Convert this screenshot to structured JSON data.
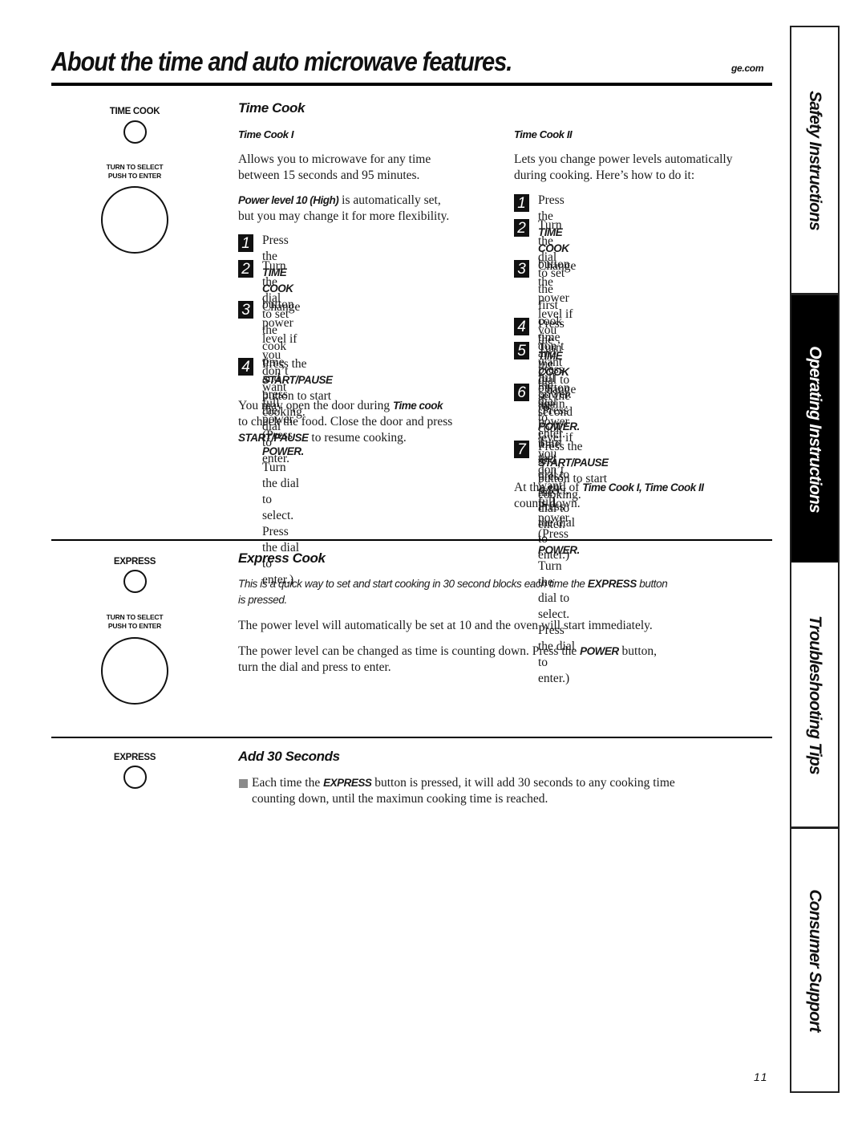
{
  "header": {
    "title": "About the time and auto microwave features.",
    "site": "ge.com"
  },
  "side_tabs": [
    {
      "label": "Safety Instructions",
      "active": false
    },
    {
      "label": "Operating Instructions",
      "active": true
    },
    {
      "label": "Troubleshooting Tips",
      "active": false
    },
    {
      "label": "Consumer Support",
      "active": false
    }
  ],
  "panels": {
    "time_cook": {
      "button_label": "TIME COOK",
      "dial_label_line1": "TURN TO SELECT",
      "dial_label_line2": "PUSH TO ENTER"
    },
    "express_cook": {
      "button_label": "EXPRESS",
      "dial_label_line1": "TURN TO SELECT",
      "dial_label_line2": "PUSH TO ENTER"
    },
    "add_30": {
      "button_label": "EXPRESS"
    }
  },
  "time_cook": {
    "heading": "Time Cook",
    "col1": {
      "subheading": "Time Cook I",
      "intro_line1": "Allows you to microwave for any time",
      "intro_line2": "between 15 seconds and 95 minutes.",
      "power_bold": "Power level 10 (High)",
      "power_rest1": " is automatically set,",
      "power_line2": "but you may change it for more flexibility.",
      "steps": [
        {
          "num": "1",
          "pre": "Press the ",
          "bold": "TIME COOK",
          "post": " button.",
          "line2": ""
        },
        {
          "num": "2",
          "pre": "Turn the dial to set the cook time and",
          "bold": "",
          "post": "",
          "line2": "press the dial to enter."
        },
        {
          "num": "3",
          "pre": "Change power level if you don’t want",
          "bold": "",
          "post": "",
          "line2_pre": "full power. (Press ",
          "line2_bold": "POWER.",
          "line2_post": " Turn the dial",
          "line3": "to select. Press the dial to enter.)"
        },
        {
          "num": "4",
          "pre": "Press the ",
          "bold": "START/PAUSE",
          "post": " button to start",
          "line2": "cooking."
        }
      ],
      "note_pre": "You may open the door during ",
      "note_bold": "Time cook",
      "note_line2": "to check the food. Close the door and press",
      "note_bold2": "START/PAUSE",
      "note_post2": " to resume cooking."
    },
    "col2": {
      "subheading": "Time Cook II",
      "intro_line1": "Lets you change power levels automatically",
      "intro_line2": "during cooking. Here’s how to do it:",
      "steps": [
        {
          "num": "1",
          "pre": "Press the ",
          "bold": "TIME COOK",
          "post": " button.",
          "line2": ""
        },
        {
          "num": "2",
          "pre": "Turn the dial to set the first cook time",
          "bold": "",
          "post": "",
          "line2": "and press the dial to enter."
        },
        {
          "num": "3",
          "pre": "Change the power level if you don’t",
          "line2_pre": "want full power. (Press ",
          "line2_bold": "POWER.",
          "line2_post": " Turn the",
          "line3": "dial to select. Press the dial to enter.)"
        },
        {
          "num": "4",
          "pre": "Press the ",
          "bold": "TIME COOK",
          "post": " button again.",
          "line2": ""
        },
        {
          "num": "5",
          "pre": "Turn the dial to set the second cook",
          "bold": "",
          "post": "",
          "line2": "time and press the dial to enter."
        },
        {
          "num": "6",
          "pre": "Change the power level if you don’t",
          "line2_pre": "want full power. (Press ",
          "line2_bold": "POWER.",
          "line2_post": " Turn the",
          "line3": "dial to select. Press the dial to enter.)"
        },
        {
          "num": "7",
          "pre": "Press the ",
          "bold": "START/PAUSE",
          "post": " button to start",
          "line2": "cooking."
        }
      ],
      "end_pre": "At the end of ",
      "end_bold": "Time Cook I, Time Cook II",
      "end_line2": "counts down."
    }
  },
  "express_cook": {
    "heading": "Express Cook",
    "intro_pre": "This is a quick way to set and start cooking in 30 second blocks each time the ",
    "intro_bold": "EXPRESS",
    "intro_post": " button",
    "intro_line2": "is pressed.",
    "para1": "The power level will automatically be set at 10 and the oven will start immediately.",
    "para2_pre": "The power level can be changed as time is counting down. Press the ",
    "para2_bold": "POWER",
    "para2_post": "  button,",
    "para2_line2": "turn the dial and press to enter."
  },
  "add_30": {
    "heading": "Add 30 Seconds",
    "text_pre": "Each time the ",
    "text_bold": "EXPRESS",
    "text_post": " button is pressed, it will add 30 seconds to any cooking time",
    "text_line2": "counting down, until the maximun cooking time is reached."
  },
  "footer": {
    "page_number": "11"
  }
}
